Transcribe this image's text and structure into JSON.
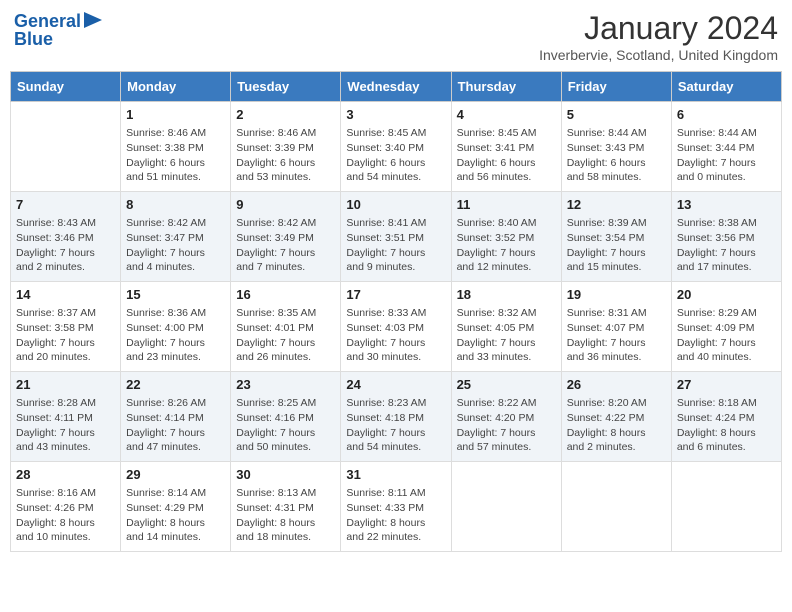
{
  "header": {
    "logo_line1": "General",
    "logo_line2": "Blue",
    "month": "January 2024",
    "location": "Inverbervie, Scotland, United Kingdom"
  },
  "days_of_week": [
    "Sunday",
    "Monday",
    "Tuesday",
    "Wednesday",
    "Thursday",
    "Friday",
    "Saturday"
  ],
  "weeks": [
    [
      {
        "day": "",
        "detail": ""
      },
      {
        "day": "1",
        "detail": "Sunrise: 8:46 AM\nSunset: 3:38 PM\nDaylight: 6 hours\nand 51 minutes."
      },
      {
        "day": "2",
        "detail": "Sunrise: 8:46 AM\nSunset: 3:39 PM\nDaylight: 6 hours\nand 53 minutes."
      },
      {
        "day": "3",
        "detail": "Sunrise: 8:45 AM\nSunset: 3:40 PM\nDaylight: 6 hours\nand 54 minutes."
      },
      {
        "day": "4",
        "detail": "Sunrise: 8:45 AM\nSunset: 3:41 PM\nDaylight: 6 hours\nand 56 minutes."
      },
      {
        "day": "5",
        "detail": "Sunrise: 8:44 AM\nSunset: 3:43 PM\nDaylight: 6 hours\nand 58 minutes."
      },
      {
        "day": "6",
        "detail": "Sunrise: 8:44 AM\nSunset: 3:44 PM\nDaylight: 7 hours\nand 0 minutes."
      }
    ],
    [
      {
        "day": "7",
        "detail": "Sunrise: 8:43 AM\nSunset: 3:46 PM\nDaylight: 7 hours\nand 2 minutes."
      },
      {
        "day": "8",
        "detail": "Sunrise: 8:42 AM\nSunset: 3:47 PM\nDaylight: 7 hours\nand 4 minutes."
      },
      {
        "day": "9",
        "detail": "Sunrise: 8:42 AM\nSunset: 3:49 PM\nDaylight: 7 hours\nand 7 minutes."
      },
      {
        "day": "10",
        "detail": "Sunrise: 8:41 AM\nSunset: 3:51 PM\nDaylight: 7 hours\nand 9 minutes."
      },
      {
        "day": "11",
        "detail": "Sunrise: 8:40 AM\nSunset: 3:52 PM\nDaylight: 7 hours\nand 12 minutes."
      },
      {
        "day": "12",
        "detail": "Sunrise: 8:39 AM\nSunset: 3:54 PM\nDaylight: 7 hours\nand 15 minutes."
      },
      {
        "day": "13",
        "detail": "Sunrise: 8:38 AM\nSunset: 3:56 PM\nDaylight: 7 hours\nand 17 minutes."
      }
    ],
    [
      {
        "day": "14",
        "detail": "Sunrise: 8:37 AM\nSunset: 3:58 PM\nDaylight: 7 hours\nand 20 minutes."
      },
      {
        "day": "15",
        "detail": "Sunrise: 8:36 AM\nSunset: 4:00 PM\nDaylight: 7 hours\nand 23 minutes."
      },
      {
        "day": "16",
        "detail": "Sunrise: 8:35 AM\nSunset: 4:01 PM\nDaylight: 7 hours\nand 26 minutes."
      },
      {
        "day": "17",
        "detail": "Sunrise: 8:33 AM\nSunset: 4:03 PM\nDaylight: 7 hours\nand 30 minutes."
      },
      {
        "day": "18",
        "detail": "Sunrise: 8:32 AM\nSunset: 4:05 PM\nDaylight: 7 hours\nand 33 minutes."
      },
      {
        "day": "19",
        "detail": "Sunrise: 8:31 AM\nSunset: 4:07 PM\nDaylight: 7 hours\nand 36 minutes."
      },
      {
        "day": "20",
        "detail": "Sunrise: 8:29 AM\nSunset: 4:09 PM\nDaylight: 7 hours\nand 40 minutes."
      }
    ],
    [
      {
        "day": "21",
        "detail": "Sunrise: 8:28 AM\nSunset: 4:11 PM\nDaylight: 7 hours\nand 43 minutes."
      },
      {
        "day": "22",
        "detail": "Sunrise: 8:26 AM\nSunset: 4:14 PM\nDaylight: 7 hours\nand 47 minutes."
      },
      {
        "day": "23",
        "detail": "Sunrise: 8:25 AM\nSunset: 4:16 PM\nDaylight: 7 hours\nand 50 minutes."
      },
      {
        "day": "24",
        "detail": "Sunrise: 8:23 AM\nSunset: 4:18 PM\nDaylight: 7 hours\nand 54 minutes."
      },
      {
        "day": "25",
        "detail": "Sunrise: 8:22 AM\nSunset: 4:20 PM\nDaylight: 7 hours\nand 57 minutes."
      },
      {
        "day": "26",
        "detail": "Sunrise: 8:20 AM\nSunset: 4:22 PM\nDaylight: 8 hours\nand 2 minutes."
      },
      {
        "day": "27",
        "detail": "Sunrise: 8:18 AM\nSunset: 4:24 PM\nDaylight: 8 hours\nand 6 minutes."
      }
    ],
    [
      {
        "day": "28",
        "detail": "Sunrise: 8:16 AM\nSunset: 4:26 PM\nDaylight: 8 hours\nand 10 minutes."
      },
      {
        "day": "29",
        "detail": "Sunrise: 8:14 AM\nSunset: 4:29 PM\nDaylight: 8 hours\nand 14 minutes."
      },
      {
        "day": "30",
        "detail": "Sunrise: 8:13 AM\nSunset: 4:31 PM\nDaylight: 8 hours\nand 18 minutes."
      },
      {
        "day": "31",
        "detail": "Sunrise: 8:11 AM\nSunset: 4:33 PM\nDaylight: 8 hours\nand 22 minutes."
      },
      {
        "day": "",
        "detail": ""
      },
      {
        "day": "",
        "detail": ""
      },
      {
        "day": "",
        "detail": ""
      }
    ]
  ]
}
